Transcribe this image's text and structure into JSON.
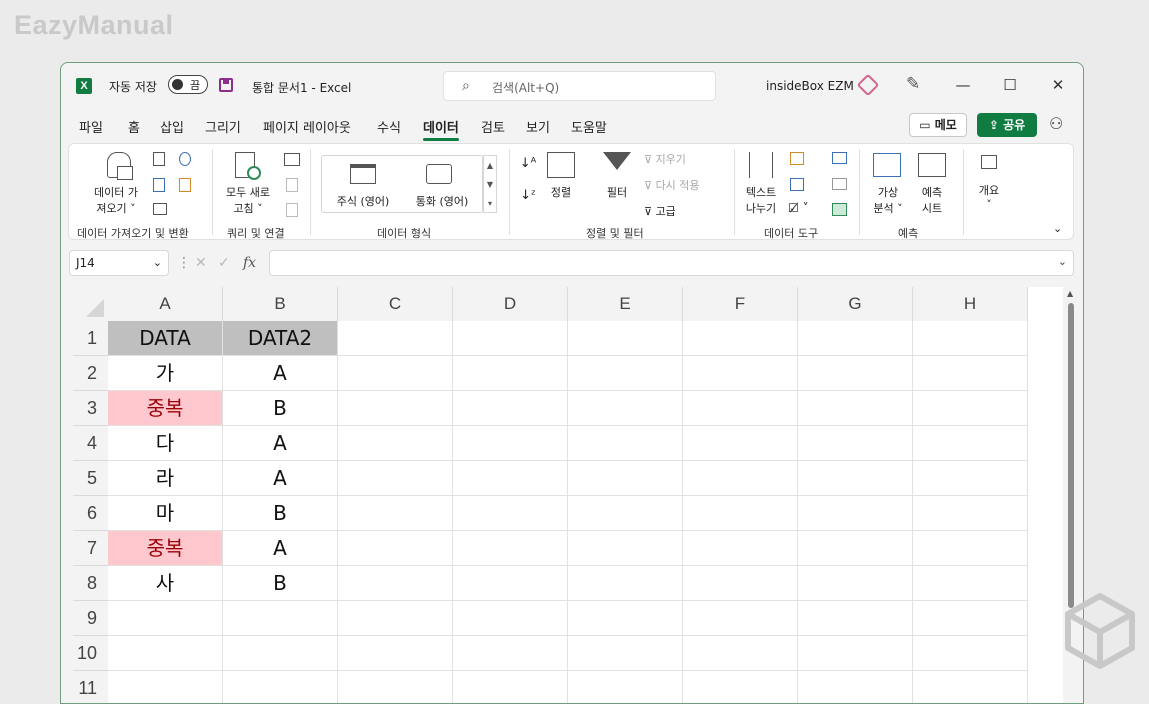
{
  "brand": "EazyManual",
  "titlebar": {
    "app_icon": "X",
    "autosave_label": "자동 저장",
    "toggle_state": "끔",
    "doc_title": "통합 문서1  -  Excel",
    "search_placeholder": "검색(Alt+Q)",
    "account_name": "insideBox EZM"
  },
  "menu": {
    "tabs": [
      "파일",
      "홈",
      "삽입",
      "그리기",
      "페이지 레이아웃",
      "수식",
      "데이터",
      "검토",
      "보기",
      "도움말"
    ],
    "active_tab": "데이터",
    "memo_label": "메모",
    "share_label": "공유"
  },
  "ribbon": {
    "get_data": {
      "label1": "데이터 가",
      "label2": "져오기",
      "group": "데이터 가져오기 및 변환"
    },
    "queries": {
      "refresh1": "모두 새로",
      "refresh2": "고침",
      "group": "쿼리 및 연결"
    },
    "data_types": {
      "stocks": "주식 (영어)",
      "currency": "통화 (영어)",
      "group": "데이터 형식"
    },
    "sort_filter": {
      "sort": "정렬",
      "filter": "필터",
      "clear": "지우기",
      "reapply": "다시 적용",
      "advanced": "고급",
      "group": "정렬 및 필터"
    },
    "data_tools": {
      "text1": "텍스트",
      "text2": "나누기",
      "group": "데이터 도구"
    },
    "forecast": {
      "whatif1": "가상",
      "whatif2": "분석",
      "sheet1": "예측",
      "sheet2": "시트",
      "group": "예측"
    },
    "outline": {
      "label": "개요"
    }
  },
  "formula_bar": {
    "name_box": "J14",
    "fx": "fx",
    "value": ""
  },
  "sheet": {
    "columns": [
      "A",
      "B",
      "C",
      "D",
      "E",
      "F",
      "G",
      "H"
    ],
    "rows": [
      "1",
      "2",
      "3",
      "4",
      "5",
      "6",
      "7",
      "8",
      "9",
      "10",
      "11"
    ],
    "colA": [
      "DATA",
      "가",
      "중복",
      "다",
      "라",
      "마",
      "중복",
      "사"
    ],
    "colB": [
      "DATA2",
      "A",
      "B",
      "A",
      "A",
      "B",
      "A",
      "B"
    ],
    "header_fill": "#bfbfbf",
    "duplicate_fill": "#ffc7ce",
    "duplicate_text": "#9c0006"
  }
}
